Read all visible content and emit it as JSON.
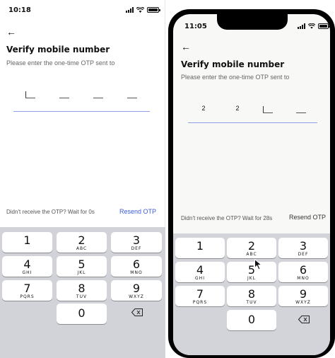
{
  "left": {
    "status": {
      "time": "10:18"
    },
    "back_icon": "arrow-left",
    "title": "Verify mobile number",
    "subtitle": "Please enter the one-time OTP sent to",
    "otp_digits": [
      "",
      "",
      "",
      ""
    ],
    "resend_info": "Didn't receive the OTP? Wait for 0s",
    "resend_label": "Resend OTP",
    "accent": "#3b5bdb"
  },
  "right": {
    "status": {
      "time": "11:05"
    },
    "back_icon": "arrow-left",
    "title": "Verify mobile number",
    "subtitle": "Please enter the one-time OTP sent to",
    "otp_digits": [
      "2",
      "2",
      "",
      ""
    ],
    "resend_info": "Didn't receive the OTP? Wait for 28s",
    "resend_label": "Resend OTP"
  },
  "keypad": {
    "keys": [
      {
        "num": "1",
        "sub": ""
      },
      {
        "num": "2",
        "sub": "ABC"
      },
      {
        "num": "3",
        "sub": "DEF"
      },
      {
        "num": "4",
        "sub": "GHI"
      },
      {
        "num": "5",
        "sub": "JKL"
      },
      {
        "num": "6",
        "sub": "MNO"
      },
      {
        "num": "7",
        "sub": "PQRS"
      },
      {
        "num": "8",
        "sub": "TUV"
      },
      {
        "num": "9",
        "sub": "WXYZ"
      },
      {
        "num": "0",
        "sub": ""
      }
    ],
    "delete_icon": "backspace-icon"
  }
}
